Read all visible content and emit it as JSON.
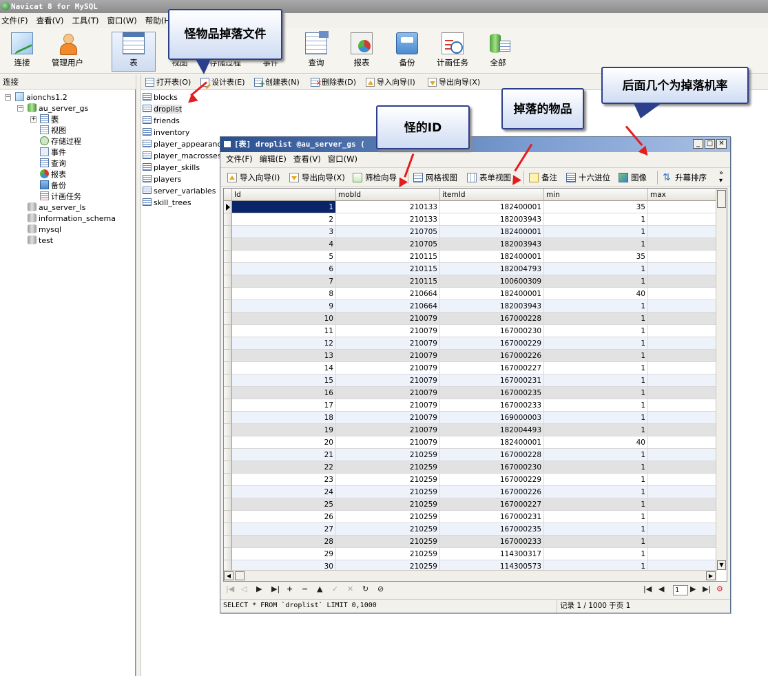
{
  "app": {
    "title": "Navicat 8 for MySQL"
  },
  "menubar": {
    "items": [
      "文件(F)",
      "查看(V)",
      "工具(T)",
      "窗口(W)",
      "帮助(H)"
    ]
  },
  "toolbar": {
    "buttons": [
      {
        "label": "连接",
        "icon": "connect-icon"
      },
      {
        "label": "管理用户",
        "icon": "user-icon"
      },
      {
        "label": "表",
        "icon": "table-icon",
        "active": true
      },
      {
        "label": "视图",
        "icon": "view-icon"
      },
      {
        "label": "存储过程",
        "icon": "procedure-icon"
      },
      {
        "label": "事件",
        "icon": "event-icon"
      },
      {
        "label": "查询",
        "icon": "query-icon"
      },
      {
        "label": "报表",
        "icon": "report-icon"
      },
      {
        "label": "备份",
        "icon": "backup-icon"
      },
      {
        "label": "计画任务",
        "icon": "schedule-icon"
      },
      {
        "label": "全部",
        "icon": "all-icon"
      }
    ]
  },
  "left": {
    "header": "连接",
    "tree": {
      "connection": "aionchs1.2",
      "db_open": "au_server_gs",
      "children": [
        "表",
        "视图",
        "存储过程",
        "事件",
        "查询",
        "报表",
        "备份",
        "计画任务"
      ],
      "other_dbs": [
        "au_server_ls",
        "information_schema",
        "mysql",
        "test"
      ]
    }
  },
  "object_toolbar": {
    "open": "打开表(O)",
    "design": "设计表(E)",
    "create": "创建表(N)",
    "delete": "删除表(D)",
    "import": "导入向导(I)",
    "export": "导出向导(X)"
  },
  "tables": [
    "blocks",
    "droplist",
    "friends",
    "inventory",
    "player_appearance",
    "player_macrosses",
    "player_skills",
    "players",
    "server_variables",
    "skill_trees"
  ],
  "window": {
    "title": "[表] droplist @au_server_gs (",
    "menu": [
      "文件(F)",
      "编辑(E)",
      "查看(V)",
      "窗口(W)"
    ],
    "tools": {
      "import": "导入向导(I)",
      "export": "导出向导(X)",
      "filter": "筛检向导",
      "grid": "网格视图",
      "form": "表单视图",
      "note": "备注",
      "hex": "十六进位",
      "image": "图像",
      "sort": "升幕排序"
    },
    "columns": [
      "Id",
      "mobId",
      "itemId",
      "min",
      "max"
    ],
    "rows": [
      [
        "1",
        "210133",
        "182400001",
        "35"
      ],
      [
        "2",
        "210133",
        "182003943",
        "1"
      ],
      [
        "3",
        "210705",
        "182400001",
        "1"
      ],
      [
        "4",
        "210705",
        "182003943",
        "1"
      ],
      [
        "5",
        "210115",
        "182400001",
        "35"
      ],
      [
        "6",
        "210115",
        "182004793",
        "1"
      ],
      [
        "7",
        "210115",
        "100600309",
        "1"
      ],
      [
        "8",
        "210664",
        "182400001",
        "40"
      ],
      [
        "9",
        "210664",
        "182003943",
        "1"
      ],
      [
        "10",
        "210079",
        "167000228",
        "1"
      ],
      [
        "11",
        "210079",
        "167000230",
        "1"
      ],
      [
        "12",
        "210079",
        "167000229",
        "1"
      ],
      [
        "13",
        "210079",
        "167000226",
        "1"
      ],
      [
        "14",
        "210079",
        "167000227",
        "1"
      ],
      [
        "15",
        "210079",
        "167000231",
        "1"
      ],
      [
        "16",
        "210079",
        "167000235",
        "1"
      ],
      [
        "17",
        "210079",
        "167000233",
        "1"
      ],
      [
        "18",
        "210079",
        "169000003",
        "1"
      ],
      [
        "19",
        "210079",
        "182004493",
        "1"
      ],
      [
        "20",
        "210079",
        "182400001",
        "40"
      ],
      [
        "21",
        "210259",
        "167000228",
        "1"
      ],
      [
        "22",
        "210259",
        "167000230",
        "1"
      ],
      [
        "23",
        "210259",
        "167000229",
        "1"
      ],
      [
        "24",
        "210259",
        "167000226",
        "1"
      ],
      [
        "25",
        "210259",
        "167000227",
        "1"
      ],
      [
        "26",
        "210259",
        "167000231",
        "1"
      ],
      [
        "27",
        "210259",
        "167000235",
        "1"
      ],
      [
        "28",
        "210259",
        "167000233",
        "1"
      ],
      [
        "29",
        "210259",
        "114300317",
        "1"
      ],
      [
        "30",
        "210259",
        "114300573",
        "1"
      ]
    ],
    "page_input": "1",
    "sql": "SELECT * FROM `droplist` LIMIT 0,1000",
    "record_status": "记录 1 / 1000 于页 1"
  },
  "callouts": {
    "drop_file": "怪物品掉落文件",
    "mob_id": "怪的ID",
    "drop_item": "掉落的物品",
    "drop_rate": "后面几个为掉落机率"
  },
  "colors": {
    "callout_border": "#2d3f8c",
    "arrow": "#e31d1d",
    "selected_cell": "#0a246a"
  }
}
